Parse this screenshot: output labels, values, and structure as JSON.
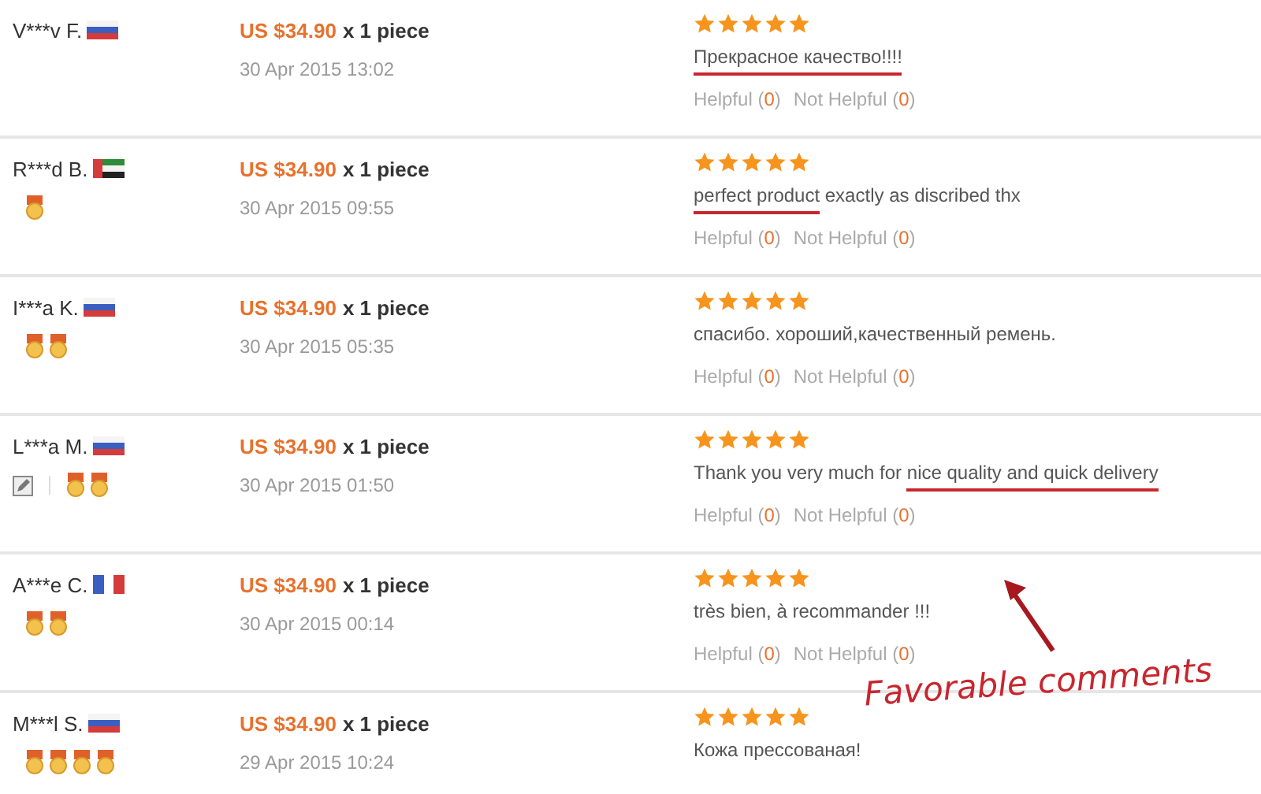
{
  "reviews": [
    {
      "buyer": "V***v F.",
      "flag": {
        "kind": "ru"
      },
      "price": "US $34.90",
      "quantity": "x 1 piece",
      "date": "30 Apr 2015 13:02",
      "stars": 5,
      "comment": [
        {
          "text": "Прекрасное качество!!!!",
          "underlined": true
        }
      ],
      "helpful": {
        "label": "Helpful (",
        "count": "0",
        "end": ")"
      },
      "not_helpful": {
        "label": "Not Helpful (",
        "count": "0",
        "end": ")"
      }
    },
    {
      "buyer": "R***d B.",
      "flag": {
        "kind": "ae"
      },
      "badges": [
        {
          "kind": "medal"
        }
      ],
      "price": "US $34.90",
      "quantity": "x 1 piece",
      "date": "30 Apr 2015 09:55",
      "stars": 5,
      "comment": [
        {
          "text": "perfect product",
          "underlined": true
        },
        {
          "text": " exactly as discribed thx",
          "underlined": false
        }
      ],
      "helpful": {
        "label": "Helpful (",
        "count": "0",
        "end": ")"
      },
      "not_helpful": {
        "label": "Not Helpful (",
        "count": "0",
        "end": ")"
      }
    },
    {
      "buyer": "I***a K.",
      "flag": {
        "kind": "ru"
      },
      "badges": [
        {
          "kind": "medal"
        },
        {
          "kind": "medal"
        }
      ],
      "price": "US $34.90",
      "quantity": "x 1 piece",
      "date": "30 Apr 2015 05:35",
      "stars": 5,
      "comment": [
        {
          "text": "спасибо. хороший,качественный ремень.",
          "underlined": false
        }
      ],
      "helpful": {
        "label": "Helpful (",
        "count": "0",
        "end": ")"
      },
      "not_helpful": {
        "label": "Not Helpful (",
        "count": "0",
        "end": ")"
      }
    },
    {
      "buyer": "L***a M.",
      "flag": {
        "kind": "ru"
      },
      "badges": [
        {
          "kind": "edit"
        },
        {
          "kind": "separator"
        },
        {
          "kind": "medal"
        },
        {
          "kind": "medal"
        }
      ],
      "price": "US $34.90",
      "quantity": "x 1 piece",
      "date": "30 Apr 2015 01:50",
      "stars": 5,
      "comment": [
        {
          "text": "Thank you very much for ",
          "underlined": false
        },
        {
          "text": "nice quality and quick delivery",
          "underlined": true
        }
      ],
      "helpful": {
        "label": "Helpful (",
        "count": "0",
        "end": ")"
      },
      "not_helpful": {
        "label": "Not Helpful (",
        "count": "0",
        "end": ")"
      }
    },
    {
      "buyer": "A***e C.",
      "flag": {
        "kind": "fr"
      },
      "badges": [
        {
          "kind": "medal"
        },
        {
          "kind": "medal"
        }
      ],
      "price": "US $34.90",
      "quantity": "x 1 piece",
      "date": "30 Apr 2015 00:14",
      "stars": 5,
      "comment": [
        {
          "text": "très bien, à recommander !!!",
          "underlined": false
        }
      ],
      "helpful": {
        "label": "Helpful (",
        "count": "0",
        "end": ")"
      },
      "not_helpful": {
        "label": "Not Helpful (",
        "count": "0",
        "end": ")"
      }
    },
    {
      "buyer": "M***l S.",
      "flag": {
        "kind": "ru"
      },
      "badges": [
        {
          "kind": "medal"
        },
        {
          "kind": "medal"
        },
        {
          "kind": "medal"
        },
        {
          "kind": "medal"
        }
      ],
      "price": "US $34.90",
      "quantity": "x 1 piece",
      "date": "29 Apr 2015 10:24",
      "stars": 5,
      "comment": [
        {
          "text": "Кожа прессованая!",
          "underlined": false
        }
      ]
    }
  ],
  "annotation": {
    "text": "Favorable comments"
  }
}
